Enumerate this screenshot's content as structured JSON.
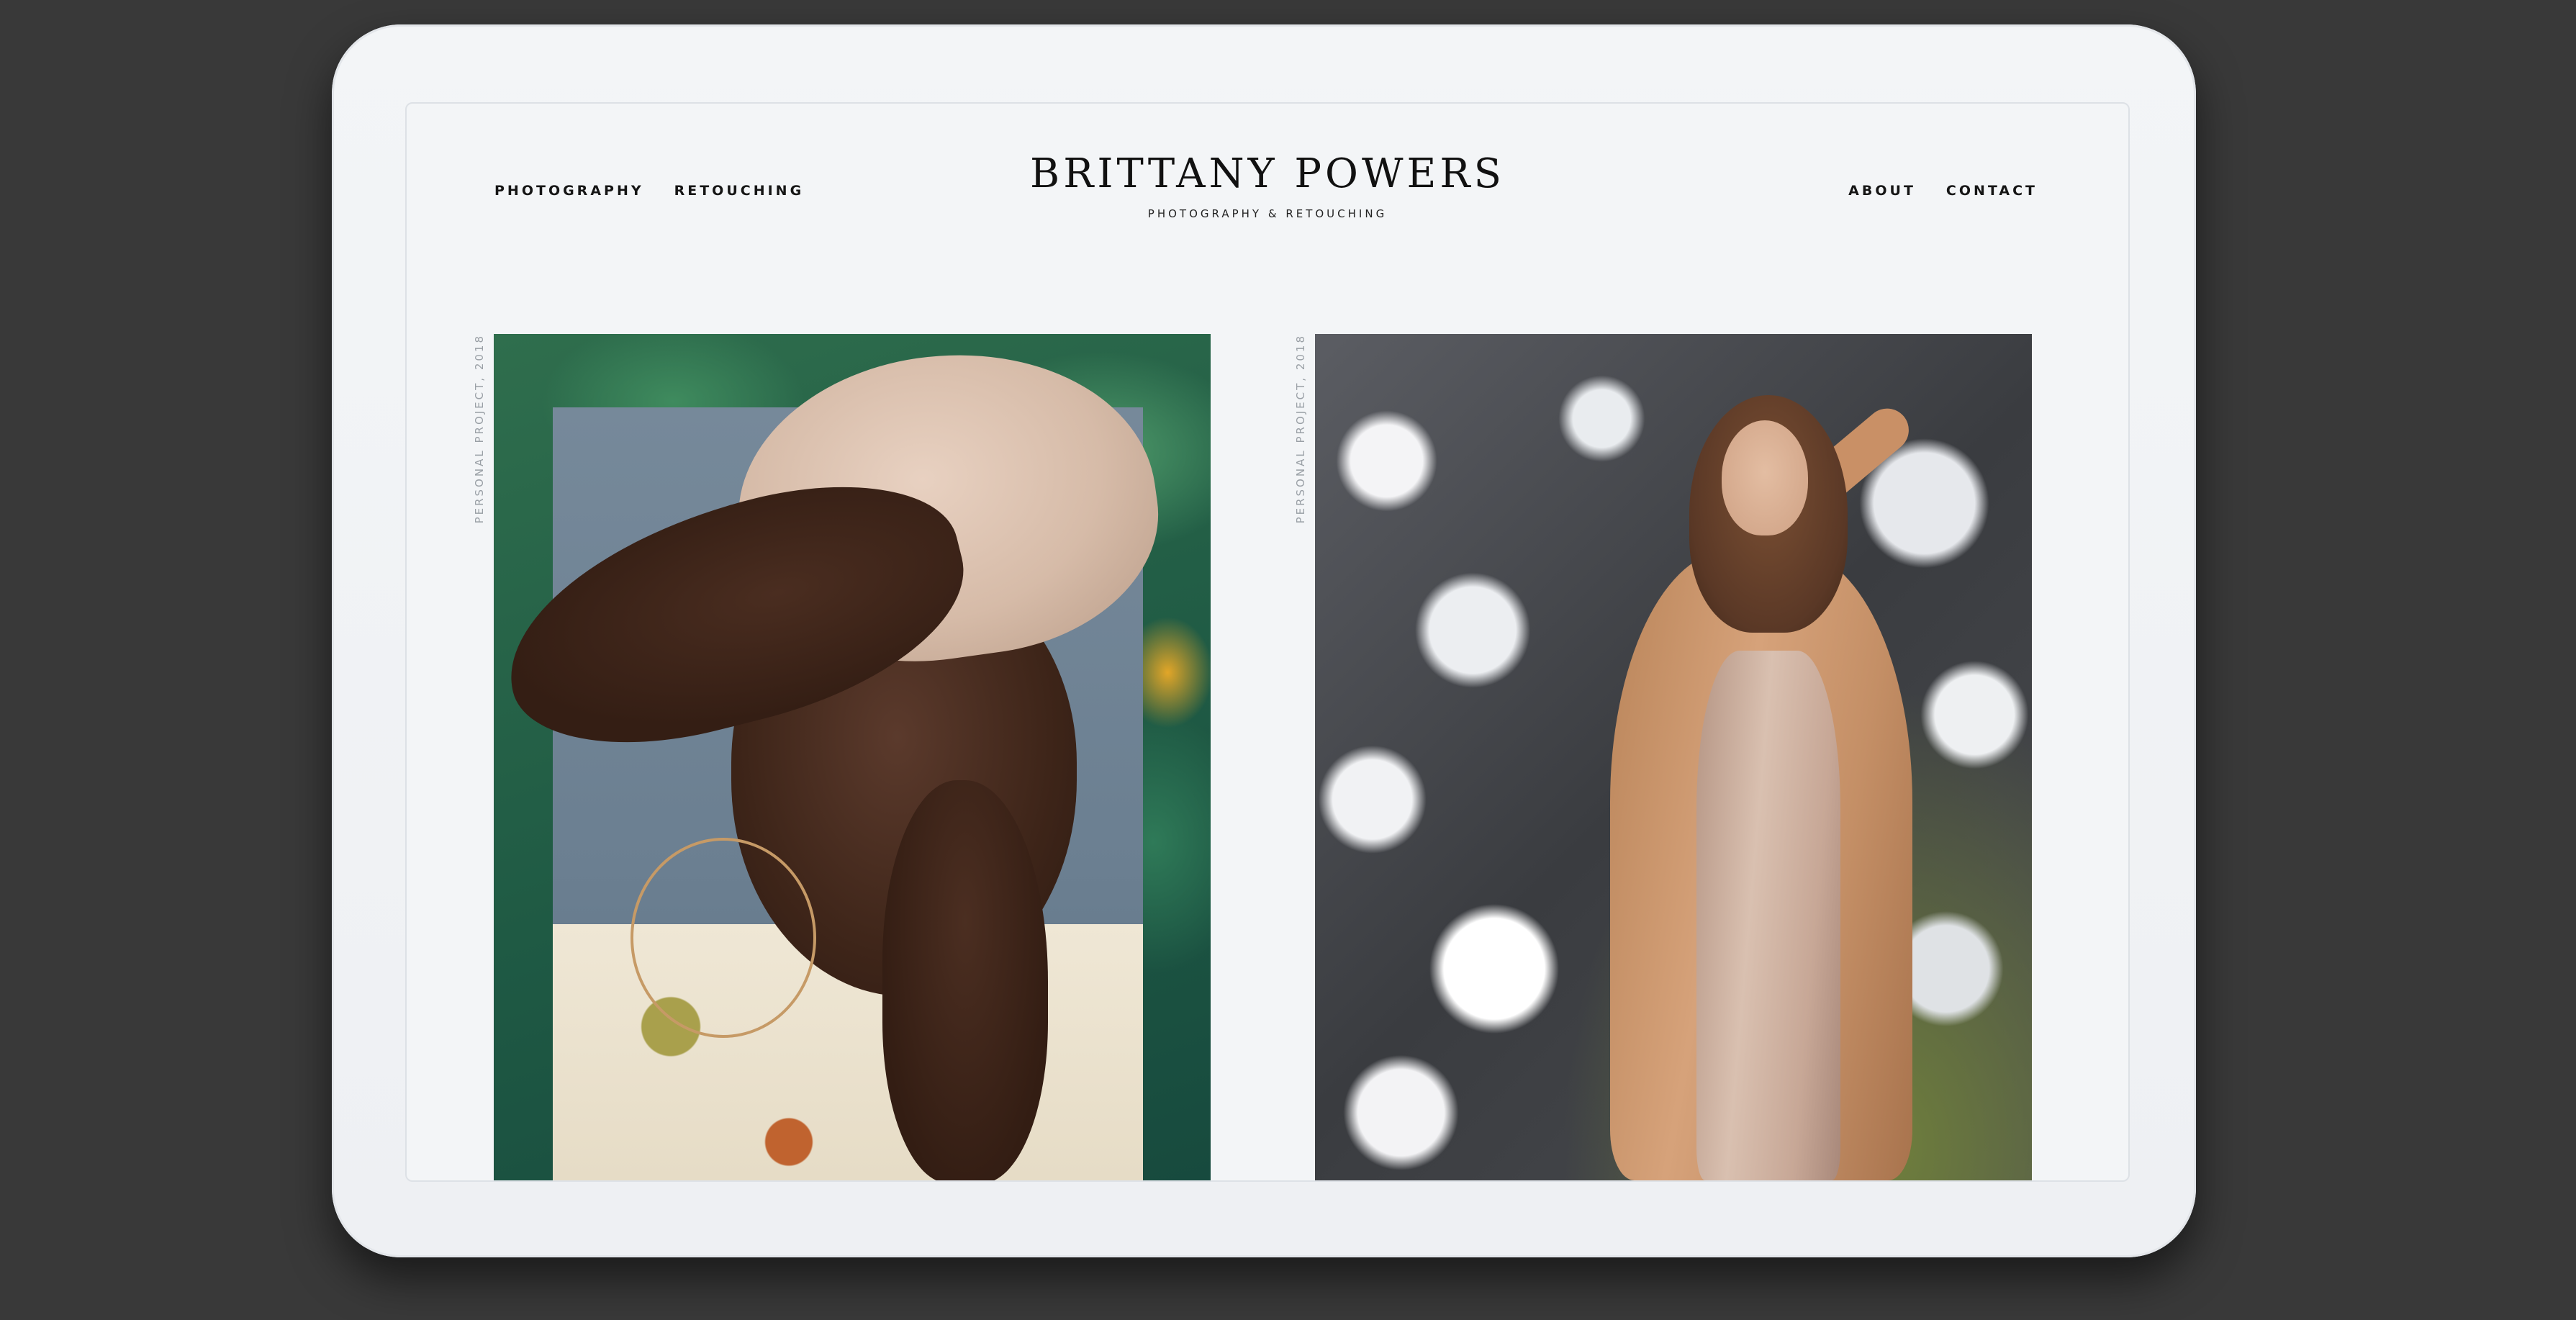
{
  "header": {
    "nav_left": [
      "PHOTOGRAPHY",
      "RETOUCHING"
    ],
    "nav_right": [
      "ABOUT",
      "CONTACT"
    ],
    "logo_title": "BRITTANY POWERS",
    "logo_subtitle": "PHOTOGRAPHY & RETOUCHING"
  },
  "gallery": {
    "items": [
      {
        "caption": "PERSONAL PROJECT, 2018"
      },
      {
        "caption": "PERSONAL PROJECT, 2018"
      }
    ]
  },
  "colors": {
    "background": "#393939",
    "device": "#f3f5f7",
    "text": "#151515",
    "caption": "#9aa0a6"
  }
}
